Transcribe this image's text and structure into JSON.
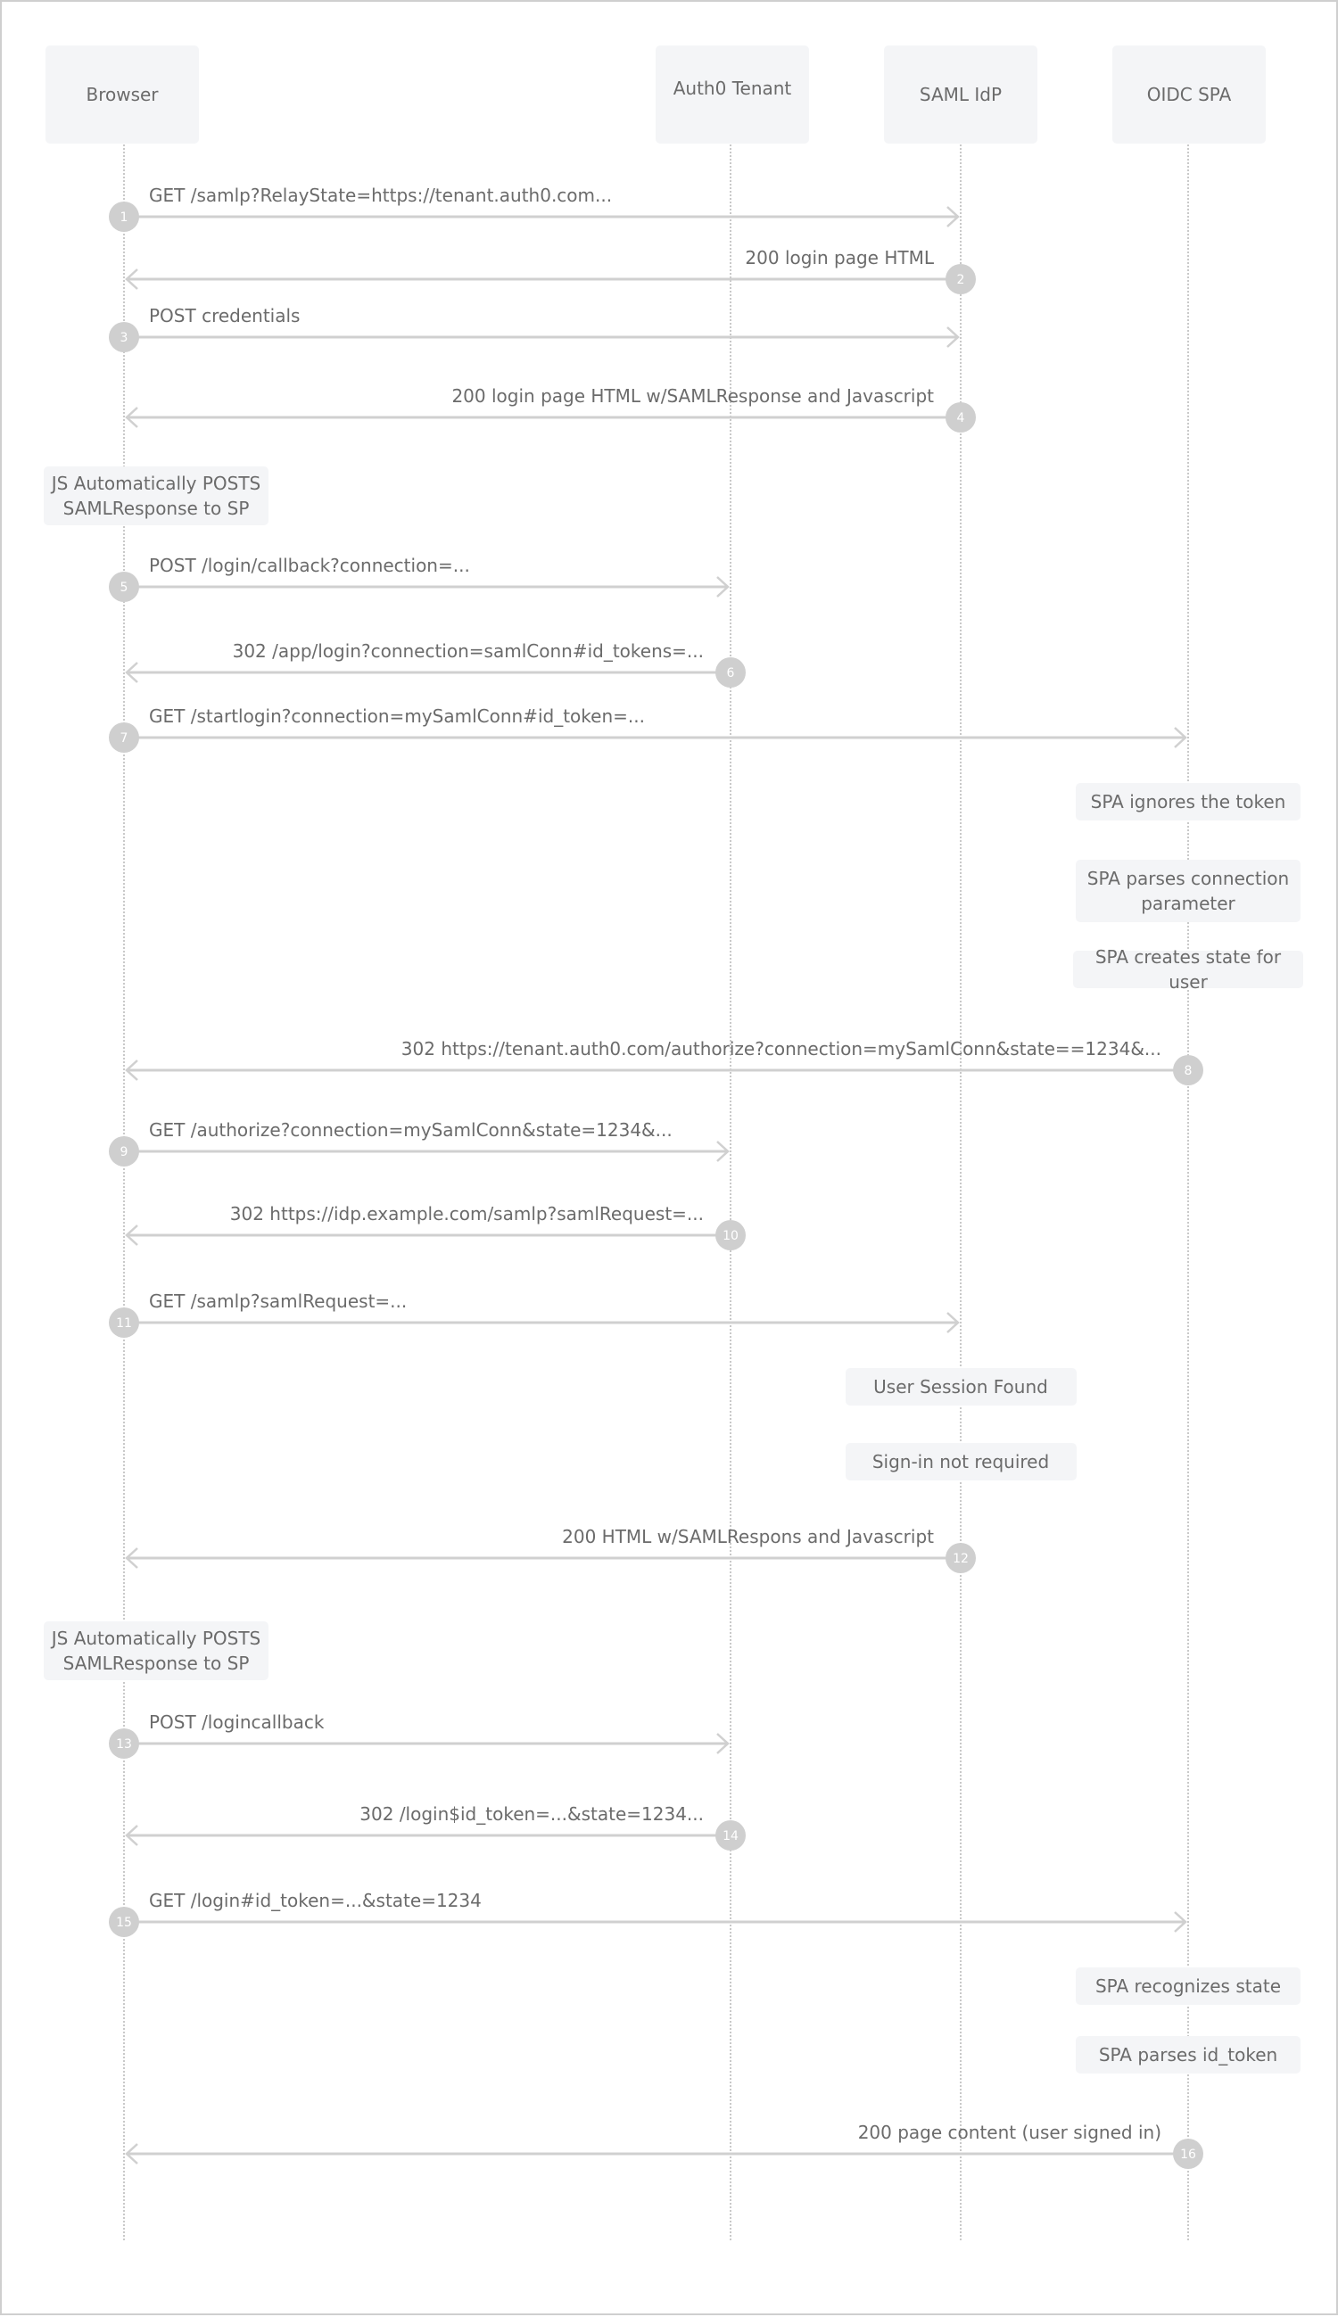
{
  "diagram": {
    "type": "sequence",
    "colors": {
      "box_fill": "#f4f5f7",
      "text": "#6b6b6b",
      "arrow": "#d0d0d0",
      "badge": "#cfcfcf",
      "lifeline": "#c9c9c9"
    },
    "participants": [
      {
        "id": "browser",
        "label": "Browser"
      },
      {
        "id": "auth0",
        "label": "Auth0 Tenant"
      },
      {
        "id": "idp",
        "label": "SAML IdP"
      },
      {
        "id": "spa",
        "label": "OIDC SPA"
      }
    ],
    "messages": [
      {
        "n": "1",
        "from": "browser",
        "to": "idp",
        "label": "GET /samlp?RelayState=https://tenant.auth0.com..."
      },
      {
        "n": "2",
        "from": "idp",
        "to": "browser",
        "label": "200 login page HTML"
      },
      {
        "n": "3",
        "from": "browser",
        "to": "idp",
        "label": "POST credentials"
      },
      {
        "n": "4",
        "from": "idp",
        "to": "browser",
        "label": "200 login page HTML w/SAMLResponse and Javascript"
      },
      {
        "n": "5",
        "from": "browser",
        "to": "auth0",
        "label": "POST /login/callback?connection=..."
      },
      {
        "n": "6",
        "from": "auth0",
        "to": "browser",
        "label": "302 /app/login?connection=samlConn#id_tokens=..."
      },
      {
        "n": "7",
        "from": "browser",
        "to": "spa",
        "label": "GET /startlogin?connection=mySamlConn#id_token=..."
      },
      {
        "n": "8",
        "from": "spa",
        "to": "browser",
        "label": "302 https://tenant.auth0.com/authorize?connection=mySamlConn&state==1234&..."
      },
      {
        "n": "9",
        "from": "browser",
        "to": "auth0",
        "label": "GET /authorize?connection=mySamlConn&state=1234&..."
      },
      {
        "n": "10",
        "from": "auth0",
        "to": "browser",
        "label": "302 https://idp.example.com/samlp?samlRequest=..."
      },
      {
        "n": "11",
        "from": "browser",
        "to": "idp",
        "label": "GET /samlp?samlRequest=..."
      },
      {
        "n": "12",
        "from": "idp",
        "to": "browser",
        "label": "200 HTML w/SAMLRespons and Javascript"
      },
      {
        "n": "13",
        "from": "browser",
        "to": "auth0",
        "label": "POST /logincallback"
      },
      {
        "n": "14",
        "from": "auth0",
        "to": "browser",
        "label": "302 /login$id_token=...&state=1234..."
      },
      {
        "n": "15",
        "from": "browser",
        "to": "spa",
        "label": "GET /login#id_token=...&state=1234"
      },
      {
        "n": "16",
        "from": "spa",
        "to": "browser",
        "label": "200 page content (user signed in)"
      }
    ],
    "notes": [
      {
        "on": "browser",
        "lines": [
          "JS Automatically POSTS",
          "SAMLResponse to SP"
        ]
      },
      {
        "on": "spa",
        "lines": [
          "SPA ignores the token"
        ]
      },
      {
        "on": "spa",
        "lines": [
          "SPA parses connection",
          "parameter"
        ]
      },
      {
        "on": "spa",
        "lines": [
          "SPA creates state for user"
        ]
      },
      {
        "on": "idp",
        "lines": [
          "User Session Found"
        ]
      },
      {
        "on": "idp",
        "lines": [
          "Sign-in not required"
        ]
      },
      {
        "on": "browser",
        "lines": [
          "JS Automatically POSTS",
          "SAMLResponse to SP"
        ]
      },
      {
        "on": "spa",
        "lines": [
          "SPA recognizes state"
        ]
      },
      {
        "on": "spa",
        "lines": [
          "SPA parses id_token"
        ]
      }
    ]
  }
}
